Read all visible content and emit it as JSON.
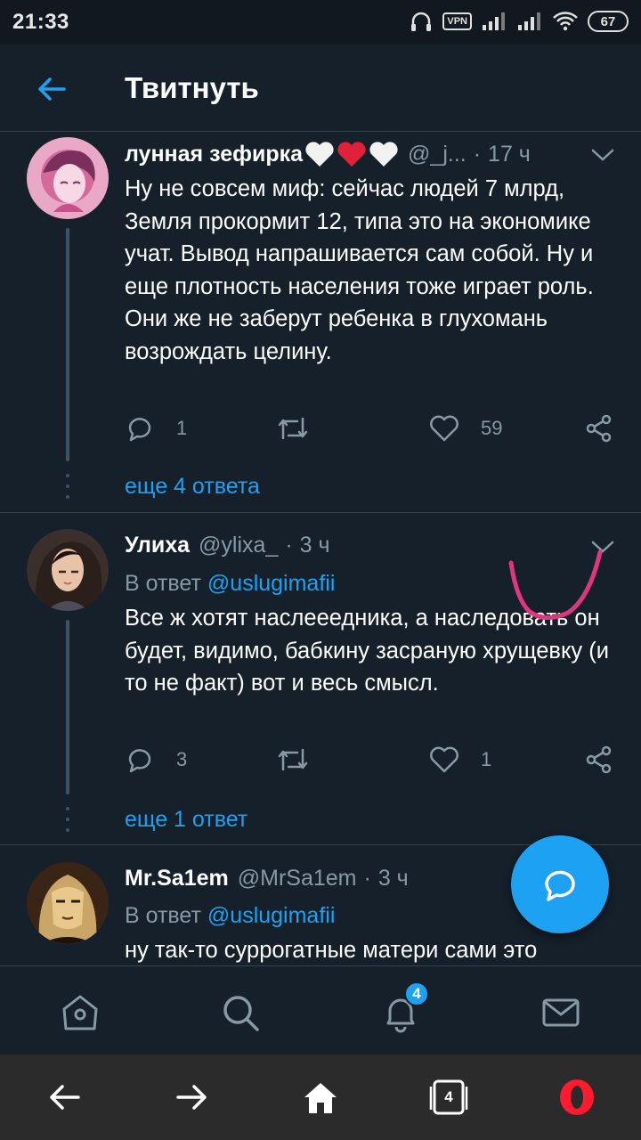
{
  "status_bar": {
    "time": "21:33",
    "vpn": "VPN",
    "battery": "67"
  },
  "header": {
    "title": "Твитнуть"
  },
  "tweets": [
    {
      "name": "лунная зефирка",
      "name_emoji": "🤍❤️🤍",
      "handle": "@_j...",
      "time": "17 ч",
      "text": "Ну не совсем миф: сейчас людей 7 млрд, Земля прокормит 12, типа это на экономике учат. Вывод напрашивается сам собой. Ну и еще плотность населения тоже играет роль. Они  же не заберут ребенка в глухомань возрождать целину.",
      "replies": "1",
      "retweets": "",
      "likes": "59",
      "more_replies": "еще 4 ответа"
    },
    {
      "name": "Улиха",
      "handle": "@ylixa_",
      "time": "3 ч",
      "reply_to_label": "В ответ",
      "reply_to_user": "@uslugimafii",
      "text": "Все ж хотят наслееедника, а наследовать он будет, видимо, бабкину засраную хрущевку (и то не факт) вот и весь смысл.",
      "replies": "3",
      "retweets": "",
      "likes": "1",
      "more_replies": "еще 1 ответ"
    },
    {
      "name": "Mr.Sa1em",
      "handle": "@MrSa1em",
      "time": "3 ч",
      "reply_to_label": "В ответ",
      "reply_to_user": "@uslugimafii",
      "text": "ну так-то суррогатные матери сами это"
    }
  ],
  "separator": "·",
  "bottom_nav": {
    "items": [
      "home-icon",
      "search-icon",
      "notifications-icon",
      "messages-icon"
    ],
    "notifications_badge": "4"
  },
  "browser_bar": {
    "items": [
      "back-arrow-icon",
      "forward-arrow-icon",
      "home-icon",
      "tabs-icon",
      "opera-icon"
    ],
    "tabs_count": "4"
  },
  "colors": {
    "background": "#15202b",
    "accent": "#1da1f2",
    "muted": "#8899a6",
    "divider": "#38444d",
    "annotation": "#e0357f"
  }
}
